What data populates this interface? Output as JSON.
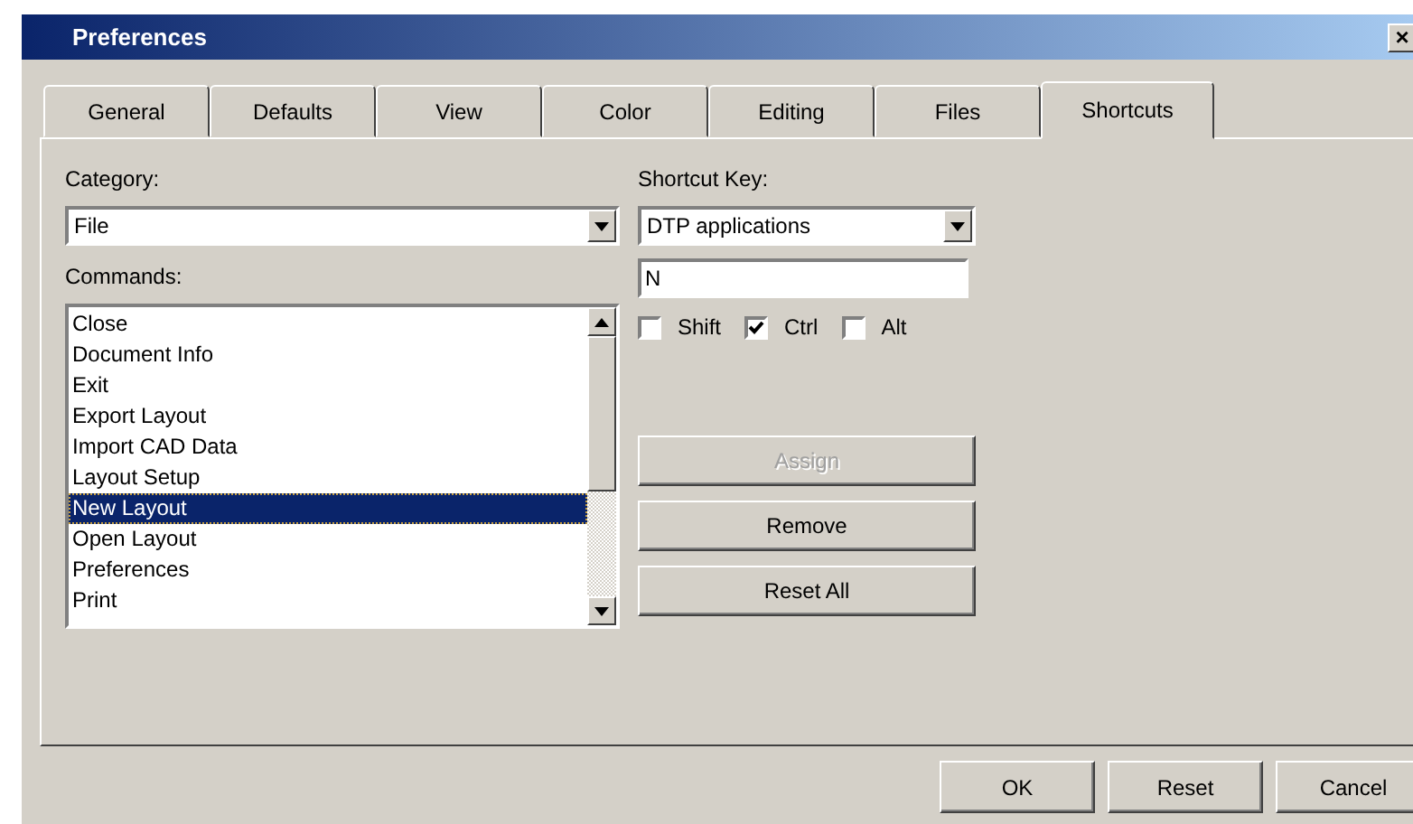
{
  "window": {
    "title": "Preferences",
    "close": "×"
  },
  "tabs": [
    {
      "label": "General",
      "selected": false
    },
    {
      "label": "Defaults",
      "selected": false
    },
    {
      "label": "View",
      "selected": false
    },
    {
      "label": "Color",
      "selected": false
    },
    {
      "label": "Editing",
      "selected": false
    },
    {
      "label": "Files",
      "selected": false
    },
    {
      "label": "Shortcuts",
      "selected": true
    }
  ],
  "category": {
    "label": "Category:",
    "value": "File"
  },
  "commands": {
    "label": "Commands:",
    "items": [
      {
        "label": "Close",
        "selected": false
      },
      {
        "label": "Document Info",
        "selected": false
      },
      {
        "label": "Exit",
        "selected": false
      },
      {
        "label": "Export Layout",
        "selected": false
      },
      {
        "label": "Import CAD Data",
        "selected": false
      },
      {
        "label": "Layout Setup",
        "selected": false
      },
      {
        "label": "New Layout",
        "selected": true
      },
      {
        "label": "Open Layout",
        "selected": false
      },
      {
        "label": "Preferences",
        "selected": false
      },
      {
        "label": "Print",
        "selected": false
      }
    ]
  },
  "shortcut_key": {
    "label": "Shortcut Key:",
    "scheme": "DTP applications",
    "key": "N"
  },
  "modifiers": [
    {
      "label": "Shift",
      "checked": false
    },
    {
      "label": "Ctrl",
      "checked": true
    },
    {
      "label": "Alt",
      "checked": false
    }
  ],
  "actions": [
    {
      "label": "Assign",
      "disabled": true
    },
    {
      "label": "Remove",
      "disabled": false
    },
    {
      "label": "Reset All",
      "disabled": false
    }
  ],
  "buttons": [
    "OK",
    "Reset",
    "Cancel"
  ]
}
